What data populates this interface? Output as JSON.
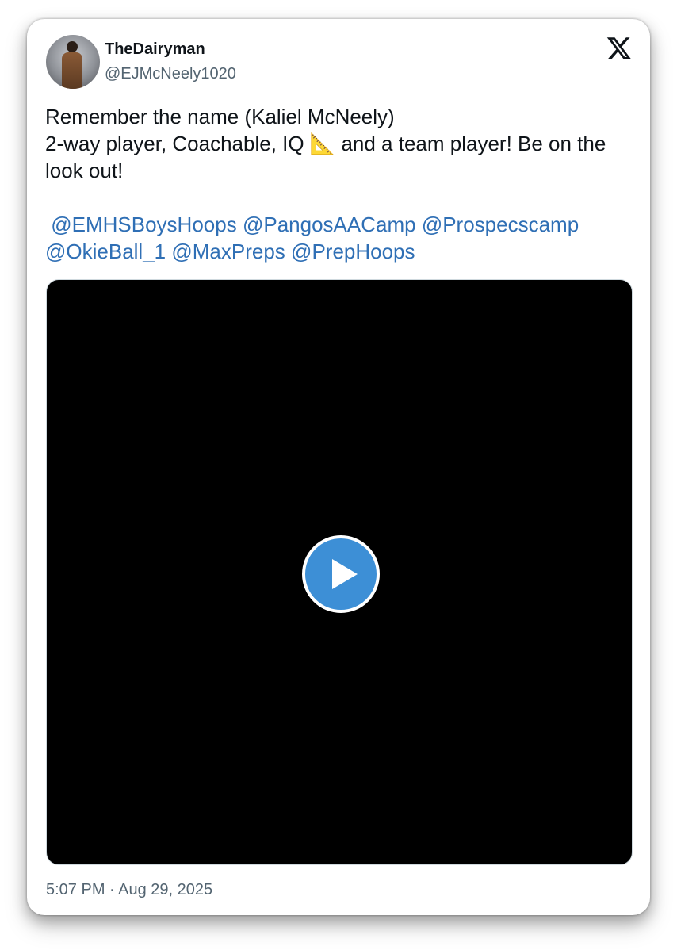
{
  "author": {
    "display_name": "TheDairyman",
    "handle": "@EJMcNeely1020"
  },
  "icons": {
    "logo": "x-logo-icon",
    "avatar": "profile-photo",
    "play": "play-icon",
    "emoji": "triangular-ruler"
  },
  "tweet": {
    "line1": "Remember the name (Kaliel McNeely)",
    "line2_before_emoji": "2-way player, Coachable, IQ ",
    "emoji": "📐",
    "line2_after_emoji": " and a team player!   Be on the look out!",
    "mentions": [
      "@EMHSBoysHoops",
      "@PangosAACamp",
      "@Prospecscamp",
      "@OkieBall_1",
      "@MaxPreps",
      "@PrepHoops"
    ]
  },
  "timestamp": "5:07 PM · Aug 29, 2025",
  "colors": {
    "mention": "#2f6fb5",
    "play_button": "#3d8fd6",
    "muted_text": "#536471"
  }
}
